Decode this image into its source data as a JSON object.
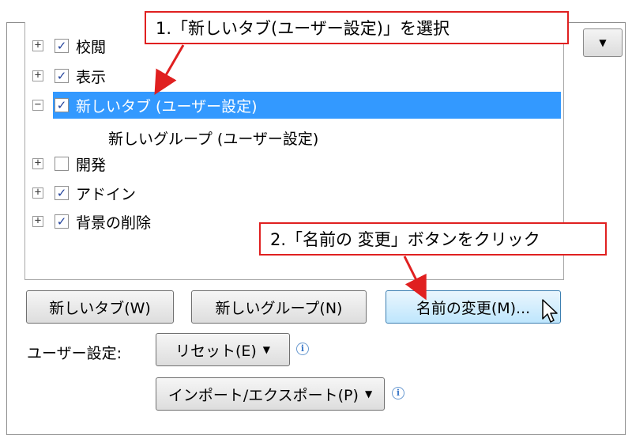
{
  "tree": {
    "items": [
      {
        "label": "校閲",
        "expander": "+",
        "checked": true
      },
      {
        "label": "表示",
        "expander": "+",
        "checked": true
      },
      {
        "label": "新しいタブ (ユーザー設定)",
        "expander": "−",
        "checked": true,
        "selected": true
      },
      {
        "label": "新しいグループ (ユーザー設定)",
        "child": true
      },
      {
        "label": "開発",
        "expander": "+",
        "checked": false
      },
      {
        "label": "アドイン",
        "expander": "+",
        "checked": true
      },
      {
        "label": "背景の削除",
        "expander": "+",
        "checked": true
      }
    ]
  },
  "buttons": {
    "new_tab": "新しいタブ(W)",
    "new_group": "新しいグループ(N)",
    "rename": "名前の変更(M)...",
    "reset": "リセット(E)",
    "import_export": "インポート/エクスポート(P)"
  },
  "labels": {
    "user_settings": "ユーザー設定:"
  },
  "icons": {
    "info": "info-icon",
    "dropdown": "dropdown-arrow-icon",
    "check": "✓"
  },
  "annotations": {
    "step1": "1.「新しいタブ(ユーザー設定)」を選択",
    "step2": "2.「名前の 変更」ボタンをクリック"
  },
  "colors": {
    "selection": "#3399ff",
    "callout_border": "#e02020"
  }
}
